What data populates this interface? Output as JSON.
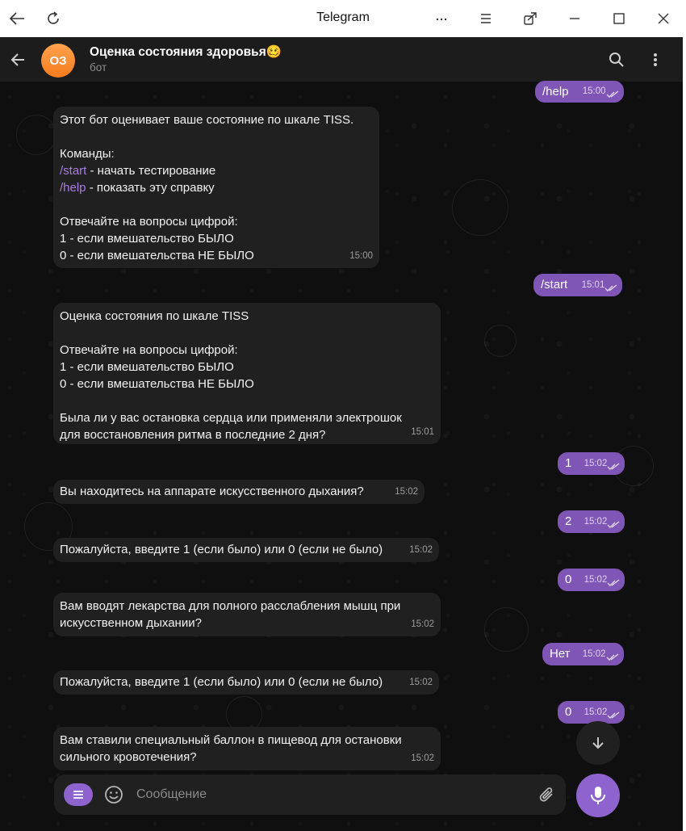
{
  "window": {
    "title": "Telegram",
    "controls": [
      "back-icon",
      "reload-icon",
      "more-dots-icon",
      "menu-icon",
      "extension-icon",
      "minimize-icon",
      "maximize-icon",
      "close-icon"
    ]
  },
  "header": {
    "avatar_initials": "ОЗ",
    "chat_name": "Оценка состояния здоровья🥴",
    "chat_status": "бот"
  },
  "messages": [
    {
      "dir": "out",
      "text": "/help",
      "time": "15:00"
    },
    {
      "dir": "in",
      "lines": [
        {
          "t": "Этот бот оценивает ваше состояние по шкале TISS."
        },
        {
          "t": ""
        },
        {
          "t": "Команды:"
        },
        {
          "cmd": "/start",
          "t": " - начать тестирование"
        },
        {
          "cmd": "/help",
          "t": " - показать эту справку"
        },
        {
          "t": ""
        },
        {
          "t": "Отвечайте на вопросы цифрой:"
        },
        {
          "t": "1 - если вмешательство БЫЛО"
        },
        {
          "t": "0 - если вмешательства НЕ БЫЛО"
        }
      ],
      "time": "15:00"
    },
    {
      "dir": "out",
      "text": "/start",
      "time": "15:01"
    },
    {
      "dir": "in",
      "text": "Оценка состояния по шкале TISS\n\nОтвечайте на вопросы цифрой:\n1 - если вмешательство БЫЛО\n0 - если вмешательства НЕ БЫЛО\n\nБыла ли у вас остановка сердца или применяли электрошок\nдля восстановления ритма в последние 2 дня?",
      "time": "15:01"
    },
    {
      "dir": "out",
      "text": "1",
      "time": "15:02"
    },
    {
      "dir": "in",
      "text": "Вы находитесь на аппарате искусственного дыхания?",
      "time": "15:02"
    },
    {
      "dir": "out",
      "text": "2",
      "time": "15:02"
    },
    {
      "dir": "in",
      "text": "Пожалуйста, введите 1 (если было) или 0 (если не было)",
      "time": "15:02"
    },
    {
      "dir": "out",
      "text": "0",
      "time": "15:02"
    },
    {
      "dir": "in",
      "text": "Вам вводят лекарства для полного расслабления мышц при\nискусственном дыхании?",
      "time": "15:02"
    },
    {
      "dir": "out",
      "text": "Нет",
      "time": "15:02"
    },
    {
      "dir": "in",
      "text": "Пожалуйста, введите 1 (если было) или 0 (если не было)",
      "time": "15:02"
    },
    {
      "dir": "out",
      "text": "0",
      "time": "15:02"
    },
    {
      "dir": "in",
      "text": "Вам ставили специальный баллон в пищевод для остановки\nсильного кровотечения?",
      "time": "15:02"
    }
  ],
  "composer": {
    "placeholder": "Сообщение"
  },
  "colors": {
    "accent": "#8e63cd",
    "outgoing_bubble": "#7f55b6",
    "incoming_bubble": "#202021",
    "command_link": "#a87ee4",
    "header_bg": "#1c1c1c",
    "avatar": "#f57c1e"
  }
}
